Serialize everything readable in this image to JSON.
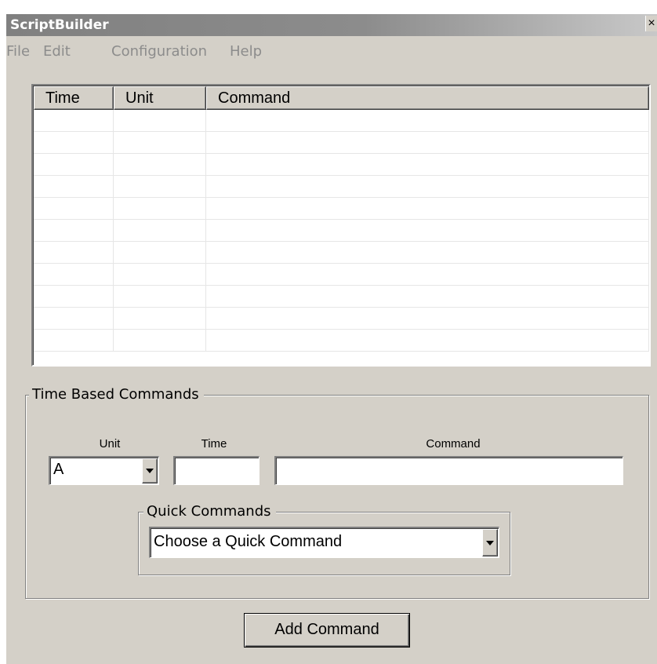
{
  "window": {
    "title": "ScriptBuilder",
    "close_glyph": "×"
  },
  "menu": {
    "items": [
      "File",
      "Edit",
      "Configuration",
      "Help"
    ]
  },
  "table": {
    "columns": [
      "Time",
      "Unit",
      "Command"
    ],
    "rows": [
      [
        "",
        "",
        ""
      ],
      [
        "",
        "",
        ""
      ],
      [
        "",
        "",
        ""
      ],
      [
        "",
        "",
        ""
      ],
      [
        "",
        "",
        ""
      ],
      [
        "",
        "",
        ""
      ],
      [
        "",
        "",
        ""
      ],
      [
        "",
        "",
        ""
      ],
      [
        "",
        "",
        ""
      ],
      [
        "",
        "",
        ""
      ],
      [
        "",
        "",
        ""
      ]
    ]
  },
  "time_based": {
    "group_label": "Time Based Commands",
    "unit_label": "Unit",
    "time_label": "Time",
    "command_label": "Command",
    "unit_value": "A",
    "time_value": "",
    "command_value": ""
  },
  "quick_commands": {
    "group_label": "Quick Commands",
    "selected": "Choose a Quick Command"
  },
  "actions": {
    "add_command_label": "Add Command"
  },
  "icons": {
    "close": "close-icon",
    "dropdown": "chevron-down-icon"
  },
  "colors": {
    "face": "#d4d0c8",
    "title_gradient_start": "#808080",
    "disabled_menu_text": "#8c8c8c"
  }
}
